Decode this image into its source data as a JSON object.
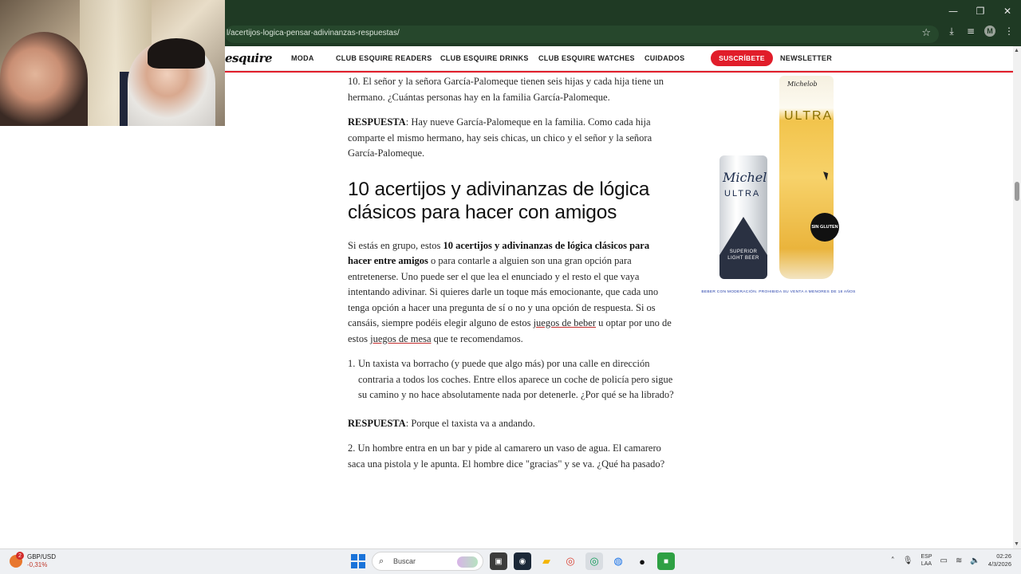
{
  "browser": {
    "url": "l/acertijos-logica-pensar-adivinanzas-respuestas/",
    "window_controls": [
      "—",
      "❐",
      "✕"
    ],
    "toolbar_icons": [
      "star-icon",
      "download-icon",
      "playlist-icon",
      "profile-icon",
      "menu-icon"
    ],
    "profile_initial": "M"
  },
  "site": {
    "logo": "esquire",
    "nav": [
      "MODA",
      "CLUB ESQUIRE READERS",
      "CLUB ESQUIRE DRINKS",
      "CLUB ESQUIRE WATCHES",
      "CUIDADOS"
    ],
    "subscribe": "SUSCRÍBETE",
    "newsletter": "NEWSLETTER",
    "accent": "#e11d2a"
  },
  "article": {
    "q10": "10. El señor y la señora García-Palomeque tienen seis hijas y cada hija tiene un hermano. ¿Cuántas personas hay en la familia García-Palomeque.",
    "a10_label": "RESPUESTA",
    "a10": ": Hay nueve García-Palomeque en la familia. Como cada hija comparte el mismo hermano, hay seis chicas, un chico y el señor y la señora García-Palomeque.",
    "heading": "10 acertijos y adivinanzas de lógica clásicos para hacer con amigos",
    "intro_1": "Si estás en grupo, estos ",
    "intro_bold": "10 acertijos y adivinanzas de lógica clásicos para hacer entre amigos",
    "intro_2": " o para contarle a alguien son una gran opción para entretenerse. Uno puede ser el que lea el enunciado y el resto el que vaya intentando adivinar. Si quieres darle un toque más emocionante, que cada uno tenga opción a hacer una pregunta de sí o no y una opción de respuesta. Si os cansáis, siempre podéis elegir alguno de estos ",
    "link_1": "juegos de beber",
    "intro_3": " u optar por uno de estos ",
    "link_2": "juegos de mesa",
    "intro_4": " que te recomendamos.",
    "q1_num": "1.",
    "q1": "Un taxista va borracho (y puede que algo más) por una calle en dirección contraria a todos los coches. Entre ellos aparece un coche de policía pero sigue su camino y no hace absolutamente nada por detenerle. ¿Por qué se ha librado?",
    "a1_label": "RESPUESTA",
    "a1": ": Porque el taxista va a andando.",
    "q2": "2. Un hombre entra en un bar y pide al camarero un vaso de agua. El camarero saca una pistola y le apunta. El hombre dice \"gracias\" y se va. ¿Qué ha pasado?"
  },
  "ad": {
    "glass_brand": "Michelob",
    "glass_ultra": "ULTRA",
    "can_brand": "Michelob",
    "can_ultra": "ULTRA",
    "can_label": "SUPERIOR LIGHT BEER",
    "badge": "SIN GLUTEN",
    "disclaimer": "BEBER CON MODERACIÓN. PROHIBIDA SU VENTA A MENORES DE 18 AÑOS"
  },
  "taskbar": {
    "ticker_name": "GBP/USD",
    "ticker_value": "-0,31%",
    "ticker_badge": "2",
    "search_placeholder": "Buscar",
    "apps": [
      "files-icon",
      "steam-icon",
      "folder-icon",
      "chrome-icon",
      "chrome-profile-icon",
      "browser-icon",
      "obs-icon",
      "app-icon"
    ],
    "lang_1": "ESP",
    "lang_2": "LAA",
    "time": "02:26",
    "date": "4/3/2026"
  }
}
